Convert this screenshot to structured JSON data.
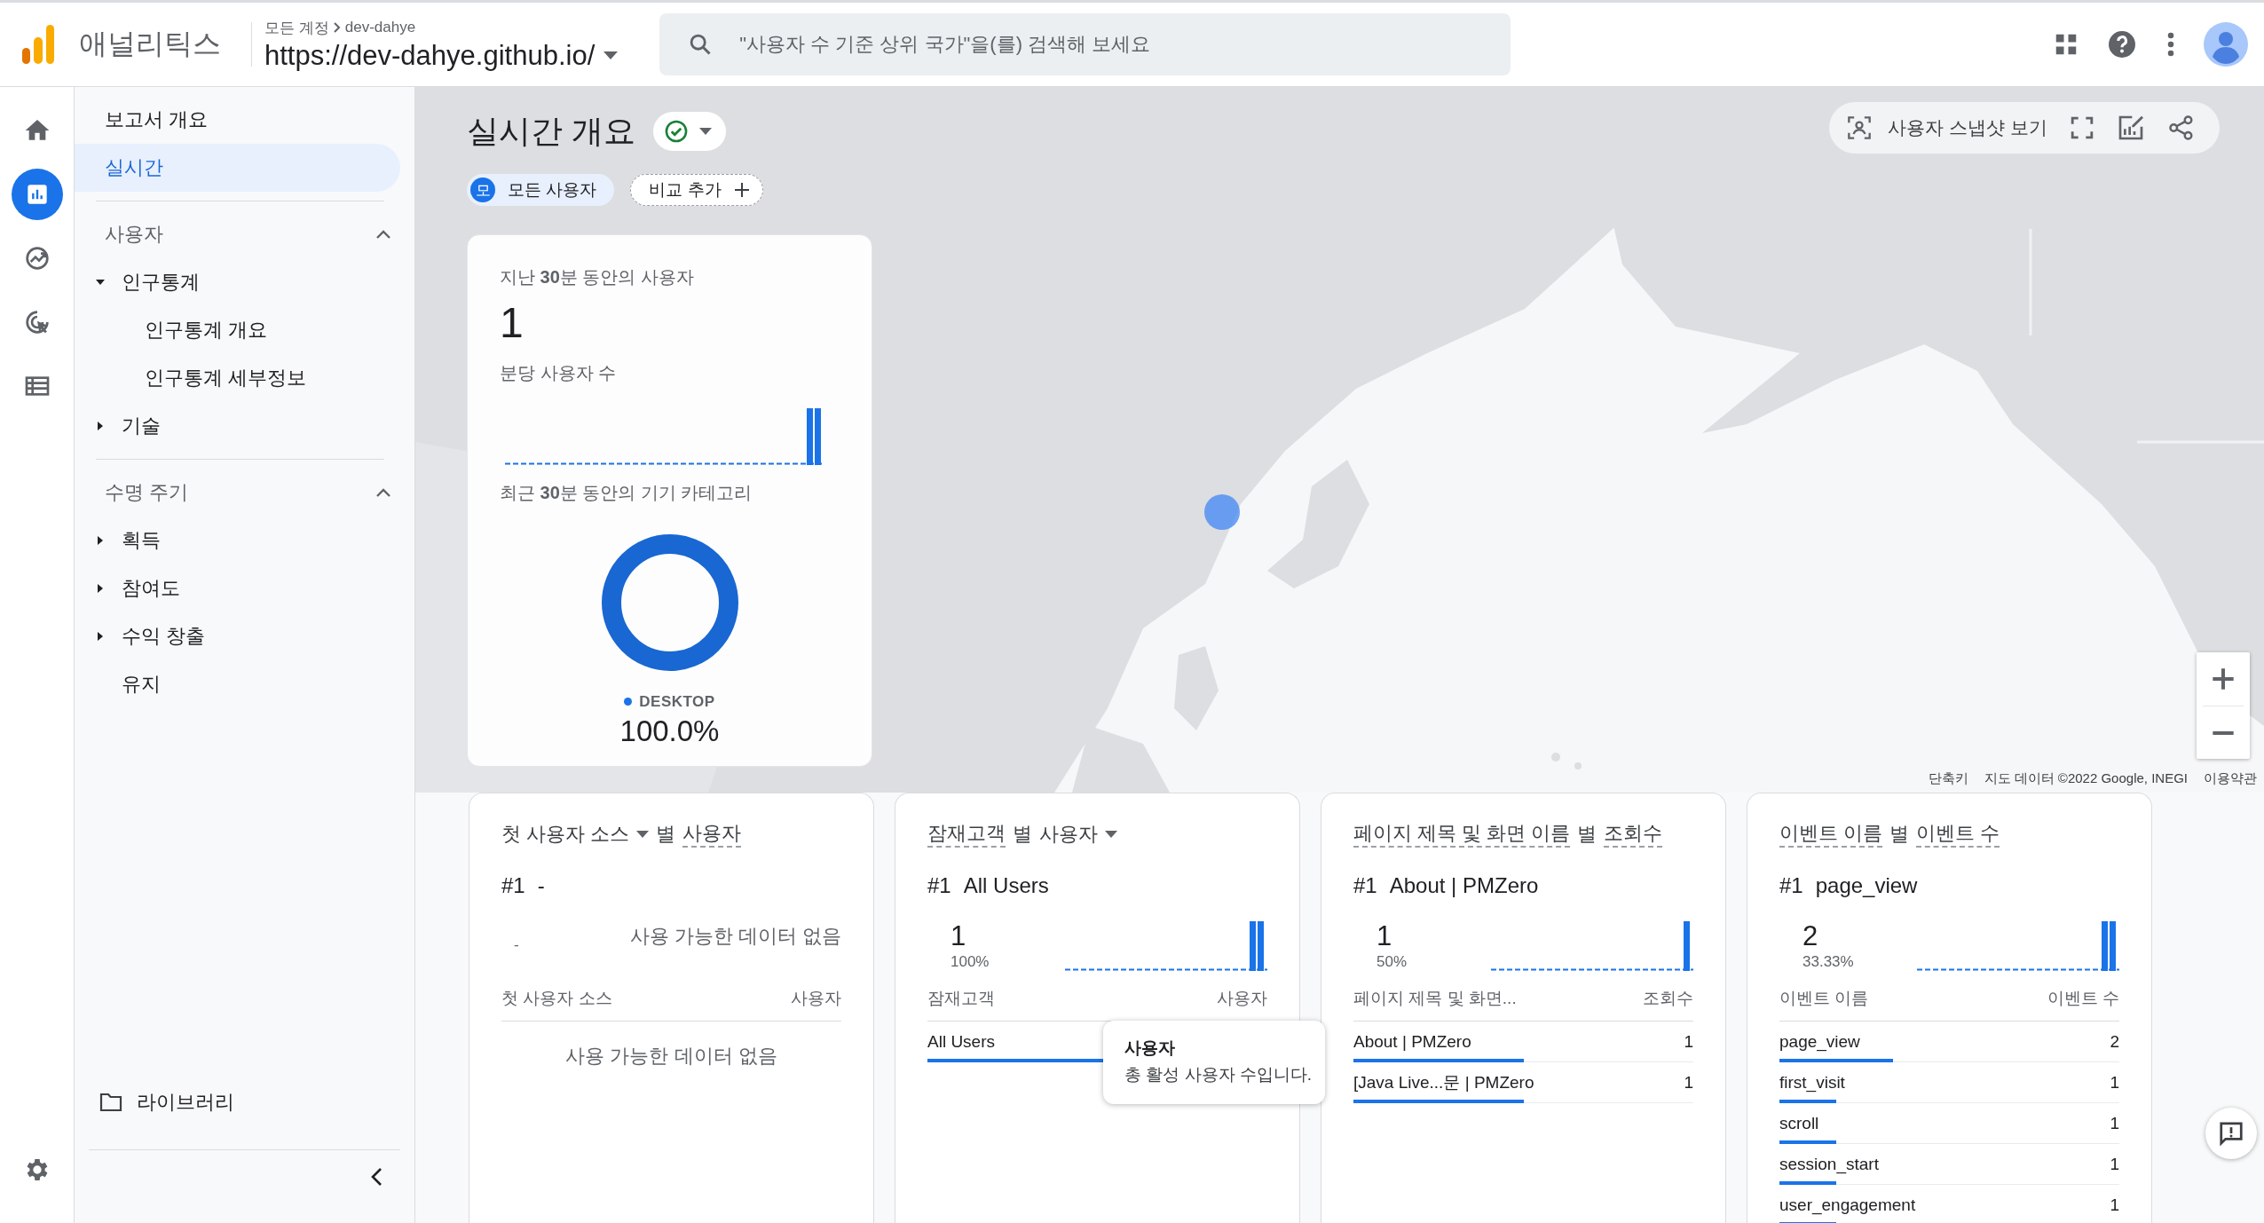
{
  "top_bar": {
    "product": "애널리틱스",
    "breadcrumb": [
      "모든 계정",
      "dev-dahye"
    ],
    "property": "https://dev-dahye.github.io/",
    "search": {
      "placeholder": "\"사용자 수 기준 상위 국가\"을(를) 검색해 보세요"
    }
  },
  "rail": [
    {
      "kind": "home",
      "selected": false
    },
    {
      "kind": "reports",
      "selected": true
    },
    {
      "kind": "explore",
      "selected": false
    },
    {
      "kind": "advertising",
      "selected": false
    },
    {
      "kind": "configure",
      "selected": false
    }
  ],
  "nav": {
    "items": [
      {
        "label": "보고서 개요",
        "selected": false
      },
      {
        "label": "실시간",
        "selected": true
      }
    ],
    "sections": [
      {
        "title": "사용자",
        "expanded": true,
        "items": [
          {
            "label": "인구통계",
            "expanded": true,
            "children": [
              {
                "label": "인구통계 개요"
              },
              {
                "label": "인구통계 세부정보"
              }
            ]
          },
          {
            "label": "기술",
            "expanded": false
          }
        ]
      },
      {
        "title": "수명 주기",
        "expanded": true,
        "items": [
          {
            "label": "획득",
            "expanded": false
          },
          {
            "label": "참여도",
            "expanded": false
          },
          {
            "label": "수익 창출",
            "expanded": false
          },
          {
            "label": "유지"
          }
        ]
      }
    ],
    "library": "라이브러리"
  },
  "header": {
    "title": "실시간 개요",
    "chips": [
      {
        "kind": "segment",
        "badge": "모",
        "label": "모든 사용자"
      },
      {
        "kind": "add",
        "label": "비교 추가"
      }
    ],
    "snapshot": "사용자 스냅샷 보기"
  },
  "map": {
    "kind": "picture",
    "attribution": [
      "단축키",
      "지도 데이터 ©2022 Google, INEGI",
      "이용약관"
    ]
  },
  "summary": {
    "users_label": "지난 **30**분 동안의 사용자",
    "users_value": "1",
    "per_minute_label": "분당 사용자 수",
    "device_label": "최근 **30**분 동안의 기기 카테고리",
    "legend": [
      {
        "label": "DESKTOP",
        "share": "100.0%"
      }
    ]
  },
  "cards": [
    {
      "title": [
        {
          "kind": "select",
          "text": "첫 사용자 소스"
        },
        {
          "kind": "text",
          "text": "별"
        },
        {
          "kind": "dimension",
          "text": "사용자"
        }
      ],
      "top": {
        "rank": "#1",
        "name": "-",
        "placeholder_value": "-",
        "message": "사용 가능한 데이터 없음"
      },
      "columns": [
        "첫 사용자 소스",
        "사용자"
      ],
      "table_message": "사용 가능한 데이터 없음"
    },
    {
      "title": [
        {
          "kind": "dimension",
          "text": "잠재고객"
        },
        {
          "kind": "text",
          "text": "별"
        },
        {
          "kind": "select",
          "text": "사용자"
        }
      ],
      "top": {
        "rank": "#1",
        "name": "All Users",
        "value": "1",
        "share": "100%"
      },
      "columns": [
        "잠재고객",
        "사용자"
      ],
      "rows": [
        {
          "name": "All Users",
          "level": 1.0
        }
      ]
    },
    {
      "title": [
        {
          "kind": "dimension",
          "text": "페이지 제목 및 화면 이름"
        },
        {
          "kind": "text",
          "text": "별"
        },
        {
          "kind": "dimension",
          "text": "조회수"
        }
      ],
      "top": {
        "rank": "#1",
        "name": "About | PMZero",
        "value": "1",
        "share": "50%"
      },
      "columns": [
        "페이지 제목 및 화면...",
        "조회수"
      ],
      "rows": [
        {
          "name": "About | PMZero",
          "value": "1",
          "level": 0.5
        },
        {
          "name": "[Java Live...문 | PMZero",
          "value": "1",
          "level": 0.5
        }
      ]
    },
    {
      "title": [
        {
          "kind": "dimension",
          "text": "이벤트 이름"
        },
        {
          "kind": "text",
          "text": "별"
        },
        {
          "kind": "dimension",
          "text": "이벤트 수"
        }
      ],
      "top": {
        "rank": "#1",
        "name": "page_view",
        "value": "2",
        "share": "33.33%"
      },
      "columns": [
        "이벤트 이름",
        "이벤트 수"
      ],
      "rows": [
        {
          "name": "page_view",
          "value": "2",
          "level": 0.333
        },
        {
          "name": "first_visit",
          "value": "1",
          "level": 0.167
        },
        {
          "name": "scroll",
          "value": "1",
          "level": 0.167
        },
        {
          "name": "session_start",
          "value": "1",
          "level": 0.167
        },
        {
          "name": "user_engagement",
          "value": "1",
          "level": 0.167
        }
      ]
    }
  ],
  "tooltip": {
    "title": "사용자",
    "text": "총 활성 사용자 수입니다."
  }
}
